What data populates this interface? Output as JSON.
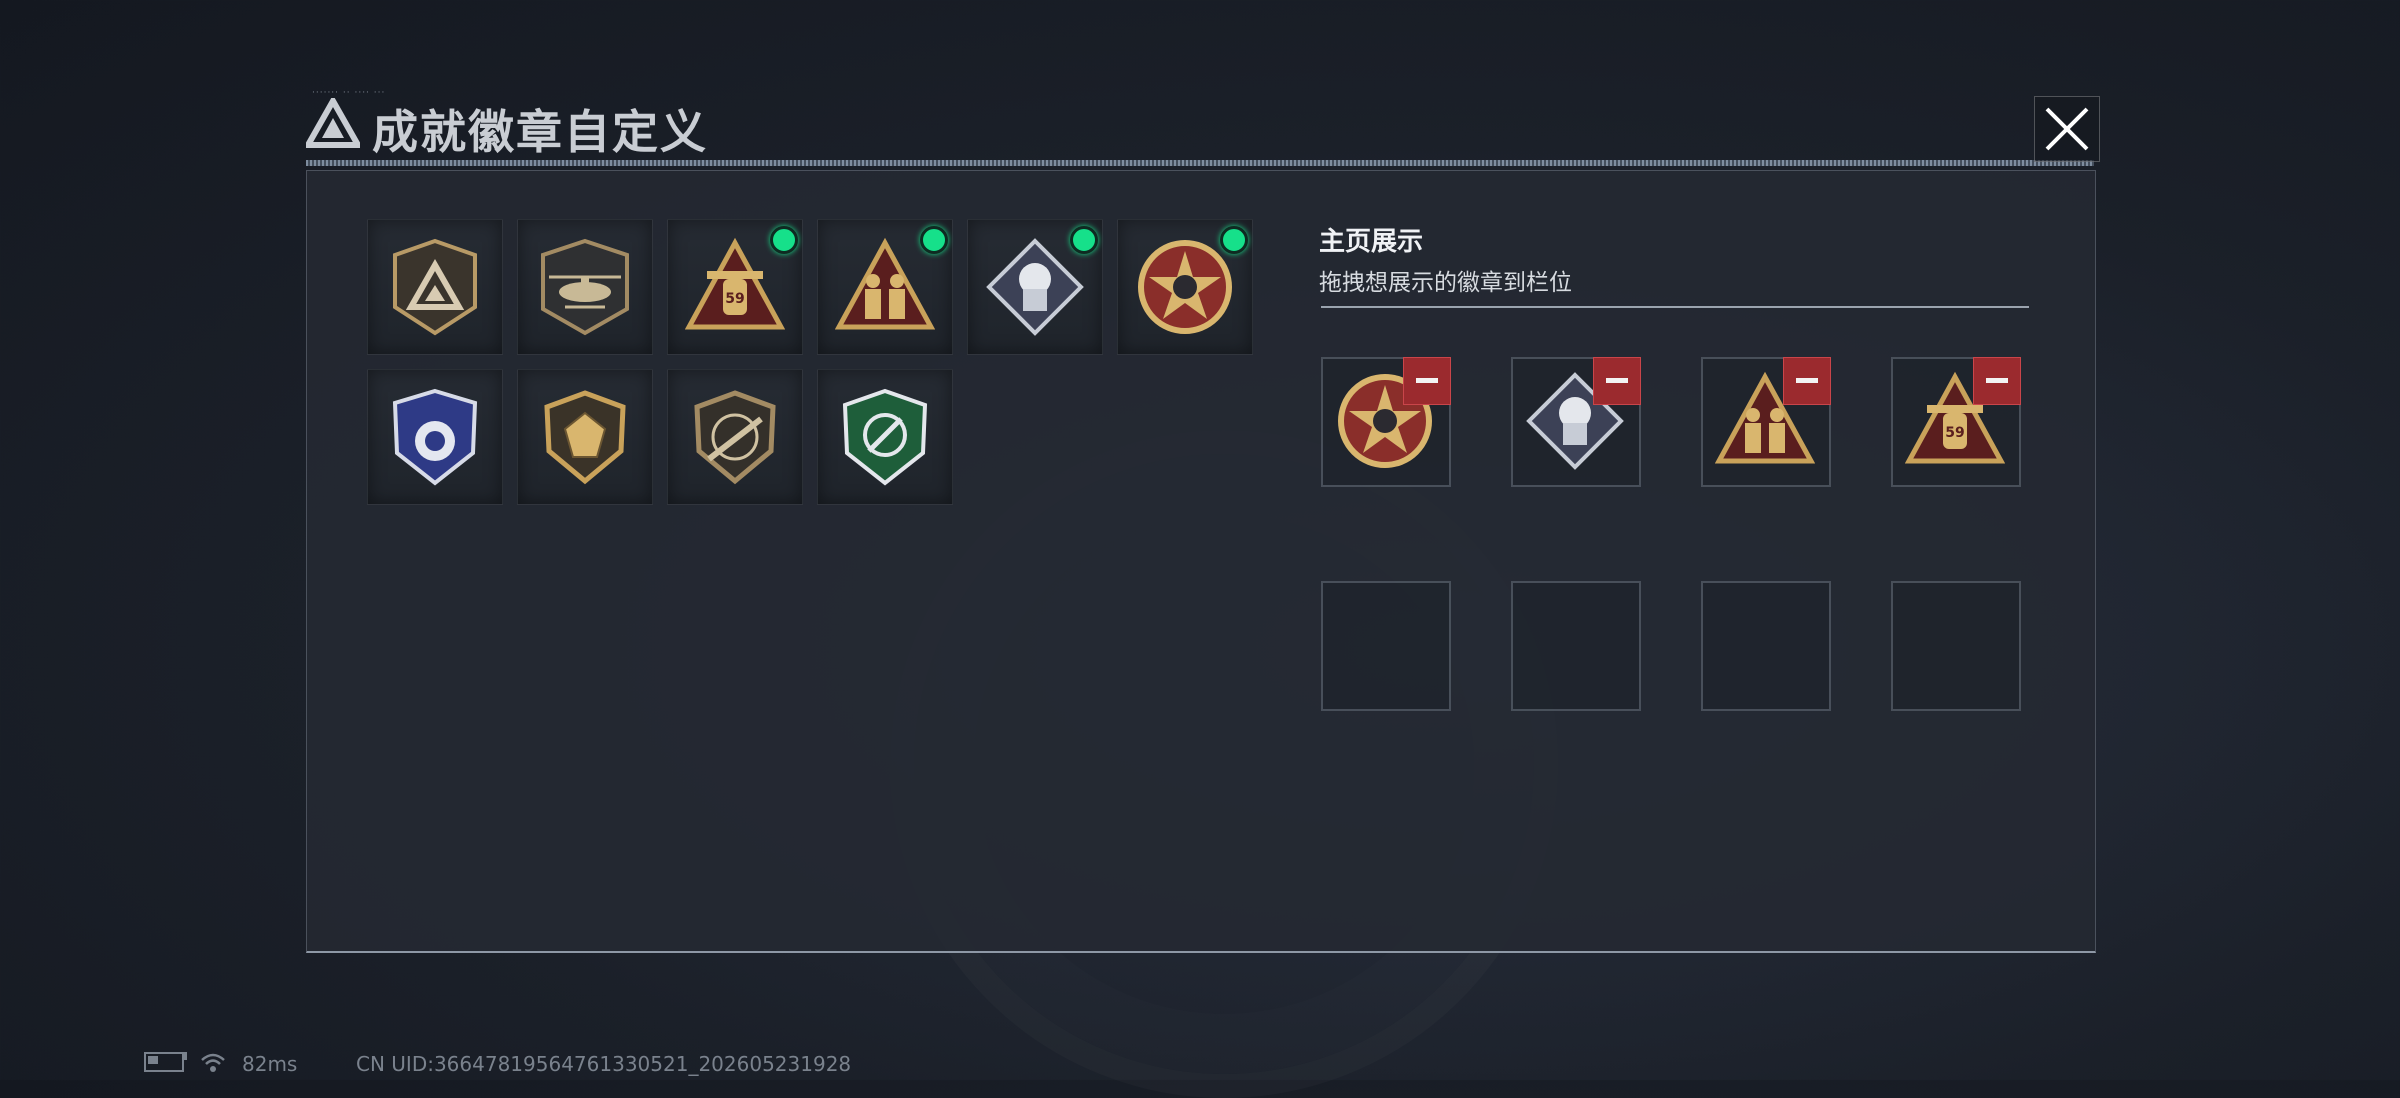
{
  "title": "成就徽章自定义",
  "title_tiny_text": "······· ·· ···· ···",
  "showcase": {
    "title": "主页展示",
    "subtitle": "拖拽想展示的徽章到栏位"
  },
  "inventory_badges": [
    {
      "icon": "triangle-logo-shield-badge",
      "is_new": false
    },
    {
      "icon": "helicopter-shield-badge",
      "is_new": false
    },
    {
      "icon": "gold-triangle-59-badge",
      "is_new": true
    },
    {
      "icon": "gold-triangle-soldiers-badge",
      "is_new": true
    },
    {
      "icon": "silver-diamond-fist-badge",
      "is_new": true
    },
    {
      "icon": "round-star-skull-badge",
      "is_new": true
    },
    {
      "icon": "blue-police-shield-badge",
      "is_new": false
    },
    {
      "icon": "gem-shield-badge",
      "is_new": false
    },
    {
      "icon": "rifle-shield-badge",
      "is_new": false
    },
    {
      "icon": "green-knife-shield-badge",
      "is_new": false
    }
  ],
  "showcase_slots": [
    {
      "icon": "round-star-skull-badge",
      "filled": true
    },
    {
      "icon": "silver-diamond-fist-badge",
      "filled": true
    },
    {
      "icon": "gold-triangle-soldiers-badge",
      "filled": true
    },
    {
      "icon": "gold-triangle-59-badge",
      "filled": true
    },
    {
      "filled": false
    },
    {
      "filled": false
    },
    {
      "filled": false
    },
    {
      "filled": false
    }
  ],
  "status": {
    "ping": "82ms",
    "uid": "CN UID:36647819564761330521_202605231928"
  },
  "colors": {
    "new_dot": "#16e08a",
    "remove_button": "#9b2a2e",
    "gold": "#c9a25a"
  }
}
